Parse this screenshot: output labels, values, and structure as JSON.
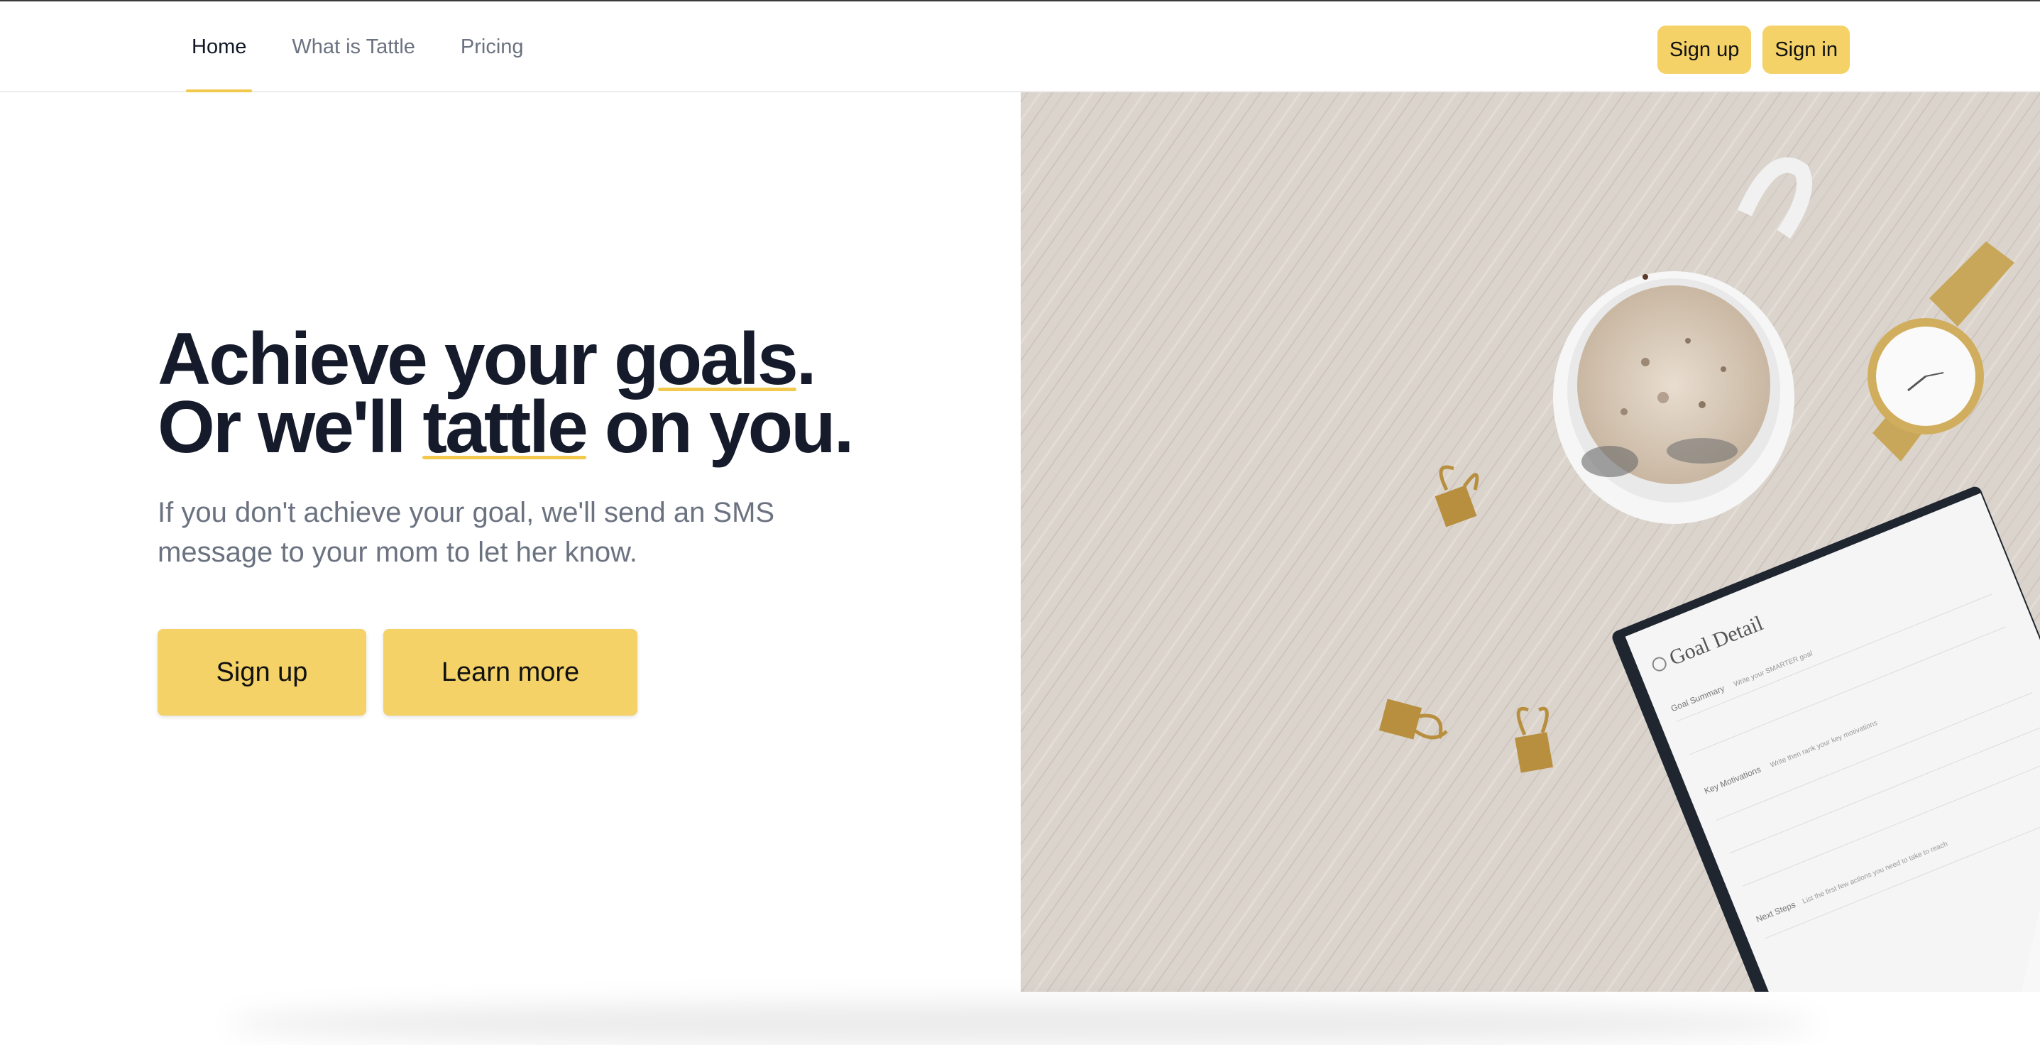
{
  "nav": {
    "items": [
      {
        "label": "Home",
        "active": true
      },
      {
        "label": "What is Tattle",
        "active": false
      },
      {
        "label": "Pricing",
        "active": false
      }
    ]
  },
  "header_buttons": {
    "signup": "Sign up",
    "signin": "Sign in"
  },
  "hero": {
    "line1_before": "Achieve your ",
    "line1_underlined": "goals",
    "line1_after": ".",
    "line2_before": "Or we'll ",
    "line2_underlined": "tattle",
    "line2_after": " on you.",
    "subtitle": "If you don't achieve your goal, we'll send an SMS message to your mom to let her know.",
    "cta_primary": "Sign up",
    "cta_secondary": "Learn more"
  },
  "photo": {
    "notebook_title": "Goal Detail",
    "notebook_section1": "Goal Summary",
    "notebook_hint1": "Write your SMARTER goal",
    "notebook_section2": "Key Motivations",
    "notebook_hint2": "Write then rank your key motivations",
    "notebook_section3": "Next Steps",
    "notebook_hint3": "List the first few actions you need to take to reach"
  },
  "colors": {
    "accent": "#f4d267",
    "underline": "#f2c94c",
    "heading": "#161b2c",
    "muted": "#6b7280",
    "desk": "#d9d2cb"
  }
}
